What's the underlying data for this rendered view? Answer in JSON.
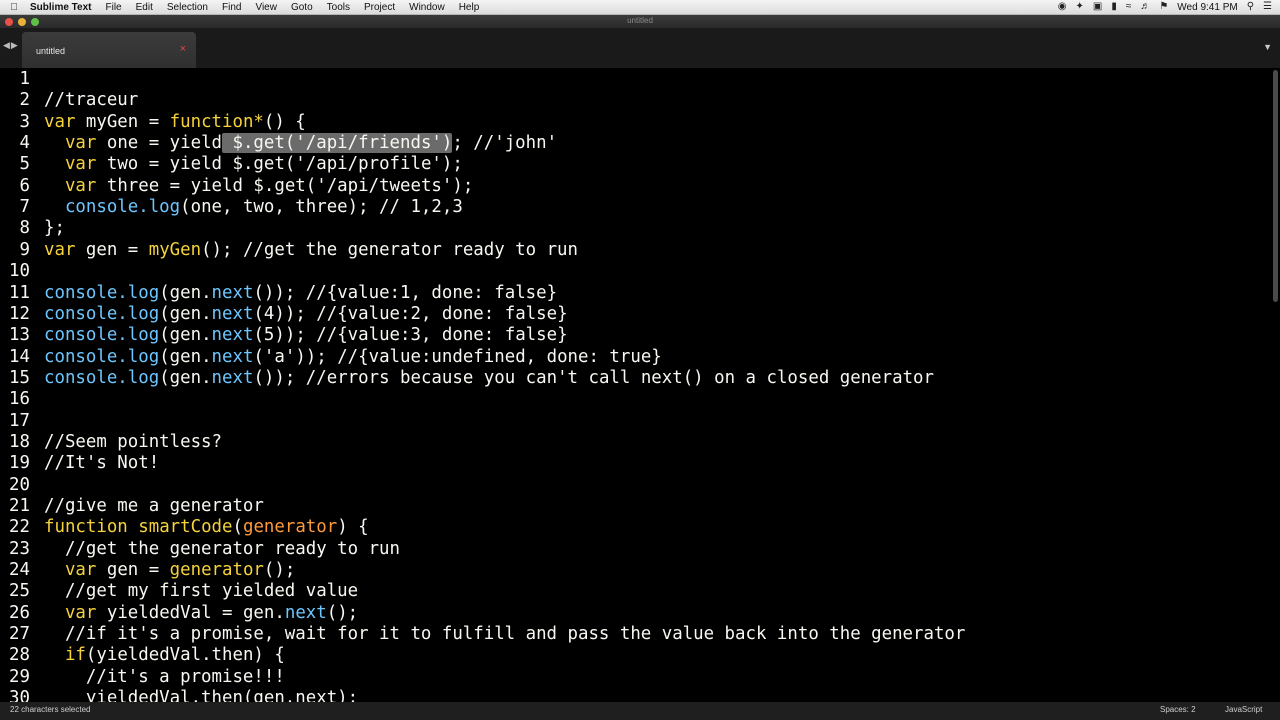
{
  "menubar": {
    "app_name": "Sublime Text",
    "items": [
      "File",
      "Edit",
      "Selection",
      "Find",
      "View",
      "Goto",
      "Tools",
      "Project",
      "Window",
      "Help"
    ],
    "clock": "Wed 9:41 PM"
  },
  "window": {
    "title": "untitled"
  },
  "tab": {
    "label": "untitled",
    "close": "×"
  },
  "status": {
    "selection": "22 characters selected",
    "spaces": "Spaces: 2",
    "syntax": "JavaScript"
  },
  "editor": {
    "lines": [
      {
        "n": "1",
        "tokens": []
      },
      {
        "n": "2",
        "tokens": [
          {
            "t": "//traceur",
            "c": ""
          }
        ]
      },
      {
        "n": "3",
        "tokens": [
          {
            "t": "var",
            "c": "kw"
          },
          {
            "t": " myGen = ",
            "c": ""
          },
          {
            "t": "function*",
            "c": "kw"
          },
          {
            "t": "() {",
            "c": ""
          }
        ]
      },
      {
        "n": "4",
        "tokens": [
          {
            "t": "  ",
            "c": ""
          },
          {
            "t": "var",
            "c": "kw"
          },
          {
            "t": " one = yield",
            "c": ""
          },
          {
            "t": " $.get('/api/friends')",
            "c": "sel"
          },
          {
            "t": "; //'john'",
            "c": ""
          }
        ]
      },
      {
        "n": "5",
        "tokens": [
          {
            "t": "  ",
            "c": ""
          },
          {
            "t": "var",
            "c": "kw"
          },
          {
            "t": " two = yield $.get('/api/profile');",
            "c": ""
          }
        ]
      },
      {
        "n": "6",
        "tokens": [
          {
            "t": "  ",
            "c": ""
          },
          {
            "t": "var",
            "c": "kw"
          },
          {
            "t": " three = yield $.get('/api/tweets');",
            "c": ""
          }
        ]
      },
      {
        "n": "7",
        "tokens": [
          {
            "t": "  console.",
            "c": "meth"
          },
          {
            "t": "log",
            "c": "meth"
          },
          {
            "t": "(one, two, three); // 1,2,3",
            "c": ""
          }
        ]
      },
      {
        "n": "8",
        "tokens": [
          {
            "t": "};",
            "c": ""
          }
        ]
      },
      {
        "n": "9",
        "tokens": [
          {
            "t": "var",
            "c": "kw"
          },
          {
            "t": " gen = ",
            "c": ""
          },
          {
            "t": "myGen",
            "c": "fn"
          },
          {
            "t": "(); //get the generator ready to run",
            "c": ""
          }
        ]
      },
      {
        "n": "10",
        "tokens": []
      },
      {
        "n": "11",
        "tokens": [
          {
            "t": "console.",
            "c": "meth"
          },
          {
            "t": "log",
            "c": "meth"
          },
          {
            "t": "(gen.",
            "c": ""
          },
          {
            "t": "next",
            "c": "meth"
          },
          {
            "t": "()); //{value:1, done: false}",
            "c": ""
          }
        ]
      },
      {
        "n": "12",
        "tokens": [
          {
            "t": "console.",
            "c": "meth"
          },
          {
            "t": "log",
            "c": "meth"
          },
          {
            "t": "(gen.",
            "c": ""
          },
          {
            "t": "next",
            "c": "meth"
          },
          {
            "t": "(4)); //{value:2, done: false}",
            "c": ""
          }
        ]
      },
      {
        "n": "13",
        "tokens": [
          {
            "t": "console.",
            "c": "meth"
          },
          {
            "t": "log",
            "c": "meth"
          },
          {
            "t": "(gen.",
            "c": ""
          },
          {
            "t": "next",
            "c": "meth"
          },
          {
            "t": "(5)); //{value:3, done: false}",
            "c": ""
          }
        ]
      },
      {
        "n": "14",
        "tokens": [
          {
            "t": "console.",
            "c": "meth"
          },
          {
            "t": "log",
            "c": "meth"
          },
          {
            "t": "(gen.",
            "c": ""
          },
          {
            "t": "next",
            "c": "meth"
          },
          {
            "t": "('a')); //{value:undefined, done: true}",
            "c": ""
          }
        ]
      },
      {
        "n": "15",
        "tokens": [
          {
            "t": "console.",
            "c": "meth"
          },
          {
            "t": "log",
            "c": "meth"
          },
          {
            "t": "(gen.",
            "c": ""
          },
          {
            "t": "next",
            "c": "meth"
          },
          {
            "t": "()); //errors because you can't call next() on a closed generator",
            "c": ""
          }
        ]
      },
      {
        "n": "16",
        "tokens": []
      },
      {
        "n": "17",
        "tokens": []
      },
      {
        "n": "18",
        "tokens": [
          {
            "t": "//Seem pointless?",
            "c": ""
          }
        ]
      },
      {
        "n": "19",
        "tokens": [
          {
            "t": "//It's Not!",
            "c": ""
          }
        ]
      },
      {
        "n": "20",
        "tokens": []
      },
      {
        "n": "21",
        "tokens": [
          {
            "t": "//give me a generator",
            "c": ""
          }
        ]
      },
      {
        "n": "22",
        "tokens": [
          {
            "t": "function",
            "c": "kw"
          },
          {
            "t": " ",
            "c": ""
          },
          {
            "t": "smartCode",
            "c": "fn"
          },
          {
            "t": "(",
            "c": ""
          },
          {
            "t": "generator",
            "c": "param"
          },
          {
            "t": ") {",
            "c": ""
          }
        ]
      },
      {
        "n": "23",
        "tokens": [
          {
            "t": "  //get the generator ready to run",
            "c": ""
          }
        ]
      },
      {
        "n": "24",
        "tokens": [
          {
            "t": "  ",
            "c": ""
          },
          {
            "t": "var",
            "c": "kw"
          },
          {
            "t": " gen = ",
            "c": ""
          },
          {
            "t": "generator",
            "c": "fn"
          },
          {
            "t": "();",
            "c": ""
          }
        ]
      },
      {
        "n": "25",
        "tokens": [
          {
            "t": "  //get my first yielded value",
            "c": ""
          }
        ]
      },
      {
        "n": "26",
        "tokens": [
          {
            "t": "  ",
            "c": ""
          },
          {
            "t": "var",
            "c": "kw"
          },
          {
            "t": " yieldedVal = gen.",
            "c": ""
          },
          {
            "t": "next",
            "c": "meth"
          },
          {
            "t": "();",
            "c": ""
          }
        ]
      },
      {
        "n": "27",
        "tokens": [
          {
            "t": "  //if it's a promise, wait for it to fulfill and pass the value back into the generator",
            "c": ""
          }
        ]
      },
      {
        "n": "28",
        "tokens": [
          {
            "t": "  ",
            "c": ""
          },
          {
            "t": "if",
            "c": "kw"
          },
          {
            "t": "(yieldedVal.then) {",
            "c": ""
          }
        ]
      },
      {
        "n": "29",
        "tokens": [
          {
            "t": "    //it's a promise!!!",
            "c": ""
          }
        ]
      },
      {
        "n": "30",
        "tokens": [
          {
            "t": "    yieldedVal.then(gen.next);",
            "c": ""
          }
        ]
      }
    ]
  },
  "colors": {
    "keyword": "#f5d23c",
    "method": "#6ec6ff",
    "param": "#fd9a3c",
    "background": "#000000"
  }
}
